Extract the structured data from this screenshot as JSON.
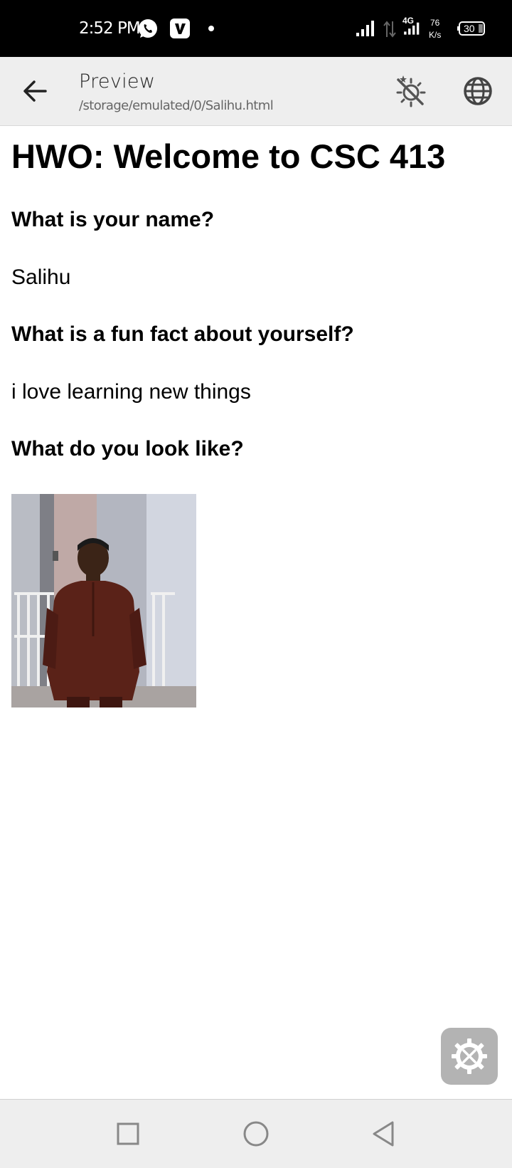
{
  "status_bar": {
    "time": "2:52 PM",
    "network_type": "4G",
    "speed_value": "76",
    "speed_unit": "K/s",
    "battery": "30",
    "icons": [
      "whatsapp-icon",
      "v-app-icon",
      "notification-dot",
      "signal-icon",
      "data-arrows-icon",
      "signal-icon",
      "battery-icon"
    ]
  },
  "app_bar": {
    "title": "Preview",
    "subtitle": "/storage/emulated/0/Salihu.html",
    "icons": [
      "back-arrow-icon",
      "theme-toggle-icon",
      "globe-icon"
    ]
  },
  "page": {
    "heading": "HWO: Welcome to CSC 413",
    "questions": [
      {
        "question": "What is your name?",
        "answer": "Salihu"
      },
      {
        "question": "What is a fun fact about yourself?",
        "answer": "i love learning new things"
      },
      {
        "question": "What do you look like?"
      }
    ]
  },
  "fab": {
    "icon": "settings-tools-icon"
  },
  "nav_bar": {
    "icons": [
      "recent-apps-icon",
      "home-icon",
      "back-icon"
    ]
  },
  "colors": {
    "status_bar_bg": "#000000",
    "app_bar_bg": "#eeeeee",
    "page_bg": "#ffffff",
    "fab_bg": "#b3b3b3",
    "nav_bar_bg": "#eeeeee"
  }
}
